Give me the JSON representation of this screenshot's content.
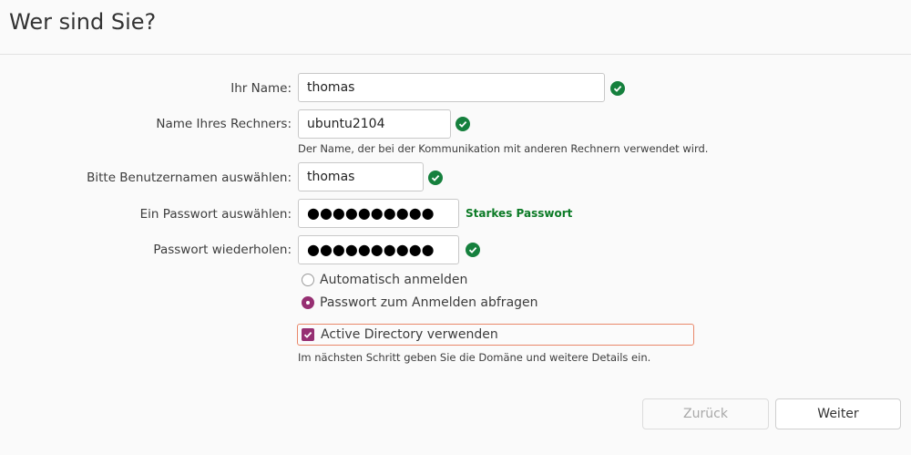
{
  "header": {
    "title": "Wer sind Sie?"
  },
  "form": {
    "name_label": "Ihr Name:",
    "name_value": "thomas",
    "computer_label": "Name Ihres Rechners:",
    "computer_value": "ubuntu2104",
    "computer_hint": "Der Name, der bei der Kommunikation mit anderen Rechnern verwendet wird.",
    "username_label": "Bitte Benutzernamen auswählen:",
    "username_value": "thomas",
    "password_label": "Ein Passwort auswählen:",
    "password_value": "●●●●●●●●●●",
    "password_strength": "Starkes Passwort",
    "repeat_label": "Passwort wiederholen:",
    "repeat_value": "●●●●●●●●●●",
    "auto_login_label": "Automatisch anmelden",
    "ask_password_label": "Passwort zum Anmelden abfragen",
    "ad_label": "Active Directory verwenden",
    "ad_hint": "Im nächsten Schritt geben Sie die Domäne und weitere Details ein."
  },
  "buttons": {
    "back": "Zurück",
    "next": "Weiter"
  },
  "colors": {
    "accent": "#962f72",
    "valid": "#15803d",
    "strong": "#0b7a25",
    "focus": "#e9886a"
  },
  "icons": {
    "valid": "check-circle-icon",
    "checkbox": "checkmark-icon"
  }
}
